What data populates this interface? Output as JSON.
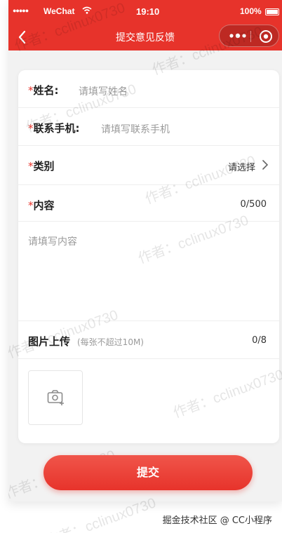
{
  "status_bar": {
    "signal": "●●●●●",
    "carrier": "WeChat",
    "time": "19:10",
    "battery": "100%"
  },
  "nav": {
    "title": "提交意见反馈"
  },
  "form": {
    "name": {
      "required_mark": "*",
      "label": "姓名:",
      "placeholder": "请填写姓名"
    },
    "phone": {
      "required_mark": "*",
      "label": "联系手机:",
      "placeholder": "请填写联系手机"
    },
    "category": {
      "required_mark": "*",
      "label": "类别",
      "value": "请选择"
    },
    "content": {
      "required_mark": "*",
      "label": "内容",
      "counter": "0/500",
      "placeholder": "请填写内容"
    },
    "images": {
      "label": "图片上传",
      "hint": "(每张不超过10M)",
      "counter": "0/8"
    }
  },
  "submit_label": "提交",
  "footer": "掘金技术社区 @ CC小程序",
  "watermark": "作者：cclinux0730",
  "colors": {
    "accent": "#e7332b"
  }
}
